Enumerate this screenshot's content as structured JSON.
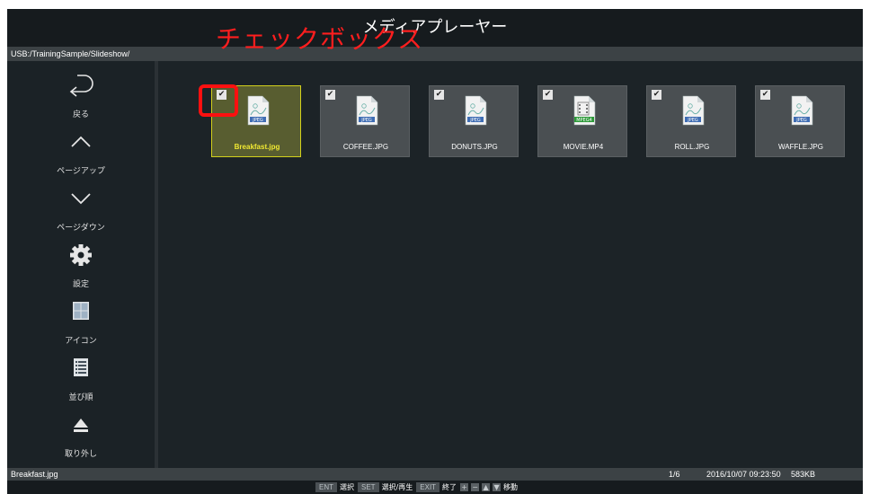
{
  "app": {
    "title": "メディアプレーヤー",
    "path": "USB:/TrainingSample/Slideshow/"
  },
  "annotation": {
    "label": "チェックボックス",
    "color": "#ff1e1e"
  },
  "sidebar": {
    "items": [
      {
        "label": "戻る",
        "icon": "back-arrow-icon"
      },
      {
        "label": "ページアップ",
        "icon": "chevron-up-icon"
      },
      {
        "label": "ページダウン",
        "icon": "chevron-down-icon"
      },
      {
        "label": "設定",
        "icon": "gear-icon"
      },
      {
        "label": "アイコン",
        "icon": "grid-view-icon"
      },
      {
        "label": "並び順",
        "icon": "list-sort-icon"
      },
      {
        "label": "取り外し",
        "icon": "eject-icon"
      }
    ]
  },
  "files": [
    {
      "name": "Breakfast.jpg",
      "type": "JPEG",
      "checked": true,
      "selected": true
    },
    {
      "name": "COFFEE.JPG",
      "type": "JPEG",
      "checked": true,
      "selected": false
    },
    {
      "name": "DONUTS.JPG",
      "type": "JPEG",
      "checked": true,
      "selected": false
    },
    {
      "name": "MOVIE.MP4",
      "type": "MPEG4",
      "checked": true,
      "selected": false
    },
    {
      "name": "ROLL.JPG",
      "type": "JPEG",
      "checked": true,
      "selected": false
    },
    {
      "name": "WAFFLE.JPG",
      "type": "JPEG",
      "checked": true,
      "selected": false
    }
  ],
  "status": {
    "filename": "Breakfast.jpg",
    "page": "1/6",
    "datetime": "2016/10/07 09:23:50",
    "size": "583KB"
  },
  "keys": {
    "ent": "ENT",
    "ent_label": "選択",
    "set": "SET",
    "set_label": "選択/再生",
    "exit": "EXIT",
    "exit_label": "終了",
    "plus": "+",
    "minus": "−",
    "up": "▲",
    "down": "▼",
    "move_label": "移動"
  },
  "colors": {
    "selected_border": "#d2d01c",
    "selected_text": "#f0e832",
    "annotation_box": "#ff1010"
  }
}
